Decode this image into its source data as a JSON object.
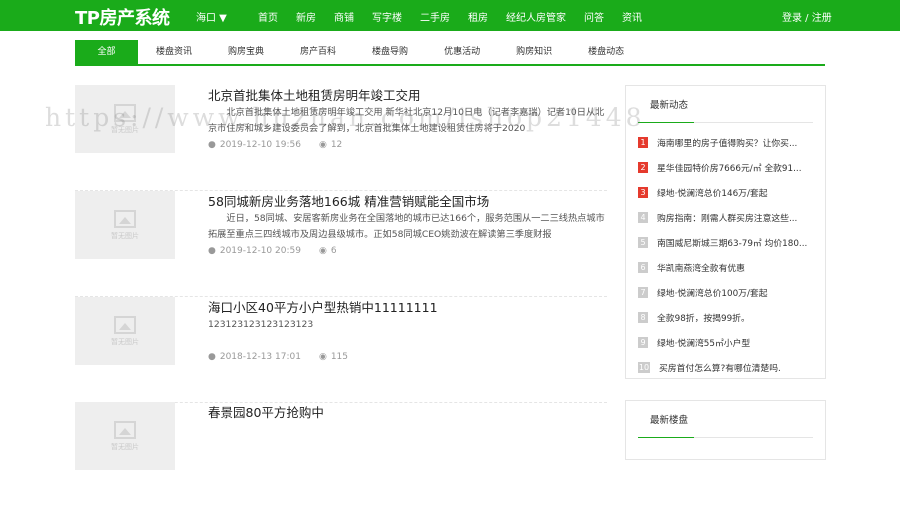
{
  "header": {
    "logo": "TP房产系统",
    "city": "海口 ▼",
    "nav": [
      "首页",
      "新房",
      "商铺",
      "写字楼",
      "二手房",
      "租房",
      "经纪人房管家",
      "问答",
      "资讯"
    ],
    "login": "登录 / 注册"
  },
  "tabs": [
    "全部",
    "楼盘资讯",
    "购房宝典",
    "房产百科",
    "楼盘导购",
    "优惠活动",
    "购房知识",
    "楼盘动态"
  ],
  "placeholder": "暂无图片",
  "articles": [
    {
      "title": "北京首批集体土地租赁房明年竣工交用",
      "desc": "北京首批集体土地租赁房明年竣工交用      新华社北京12月10日电（记者李嘉瑞）记者10日从北京市住房和城乡建设委员会了解到，北京首批集体土地建设租赁住房将于2020",
      "date": "2019-12-10 19:56",
      "views": "12"
    },
    {
      "title": "58同城新房业务落地166城 精准营销赋能全国市场",
      "desc": "近日，58同城、安居客新房业务在全国落地的城市已达166个，服务范围从一二三线热点城市拓展至重点三四线城市及周边县级城市。正如58同城CEO姚劲波在解读第三季度财报",
      "date": "2019-12-10 20:59",
      "views": "6"
    },
    {
      "title": "海口小区40平方小户型热销中11111111",
      "desc": "123123123123123123",
      "date": "2018-12-13 17:01",
      "views": "115"
    },
    {
      "title": "春景园80平方抢购中",
      "desc": "",
      "date": "",
      "views": ""
    }
  ],
  "sidebar": {
    "news_title": "最新动态",
    "news": [
      "海南哪里的房子值得购买？让你买...",
      "星华佳园特价房7666元/㎡ 全款91...",
      "绿地·悦澜湾总价146万/套起",
      "购房指南：刚需人群买房注意这些...",
      "南国威尼斯城三期63-79㎡ 均价180...",
      "华凯南燕湾全款有优惠",
      "绿地·悦澜湾总价100万/套起",
      "全款98折，按揭99折。",
      "绿地·悦澜湾55㎡小户型",
      "买房首付怎么算?有哪位清楚吗."
    ],
    "estates_title": "最新楼盘"
  },
  "watermark": "https://www.huzhan.com/ishop21448"
}
